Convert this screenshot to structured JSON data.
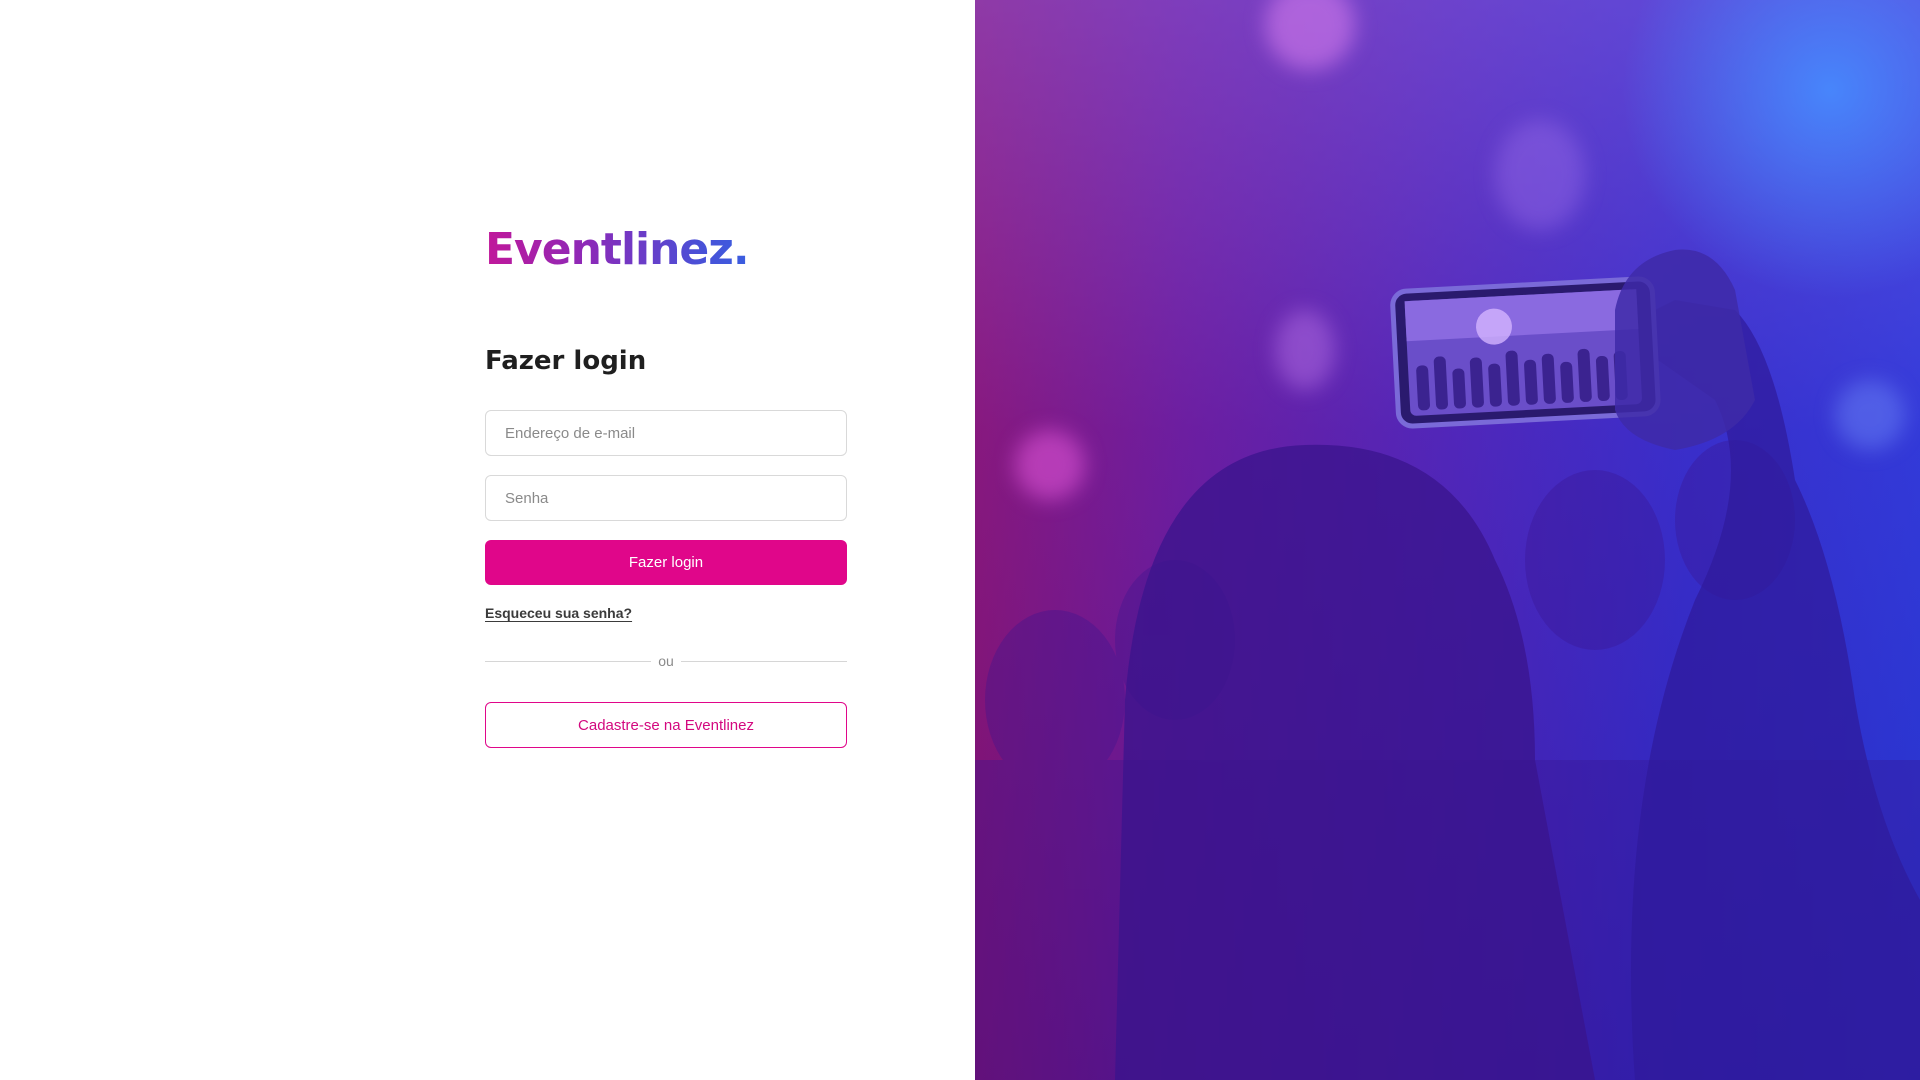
{
  "brand": {
    "logo_text": "Eventlinez."
  },
  "login": {
    "title": "Fazer login",
    "email_placeholder": "Endereço de e-mail",
    "password_placeholder": "Senha",
    "submit_label": "Fazer login",
    "forgot_password_label": "Esqueceu sua senha?",
    "divider_label": "ou",
    "signup_label": "Cadastre-se na Eventlinez"
  },
  "colors": {
    "primary": "#e0068a",
    "title_text": "#1f1f1f",
    "logo_gradient_start": "#c1189a",
    "logo_gradient_end": "#3a5ee0",
    "hero_gradient_start": "#8a0f6e",
    "hero_gradient_end": "#2736d8"
  },
  "hero": {
    "image_subject": "concert-crowd-phone-photo"
  }
}
